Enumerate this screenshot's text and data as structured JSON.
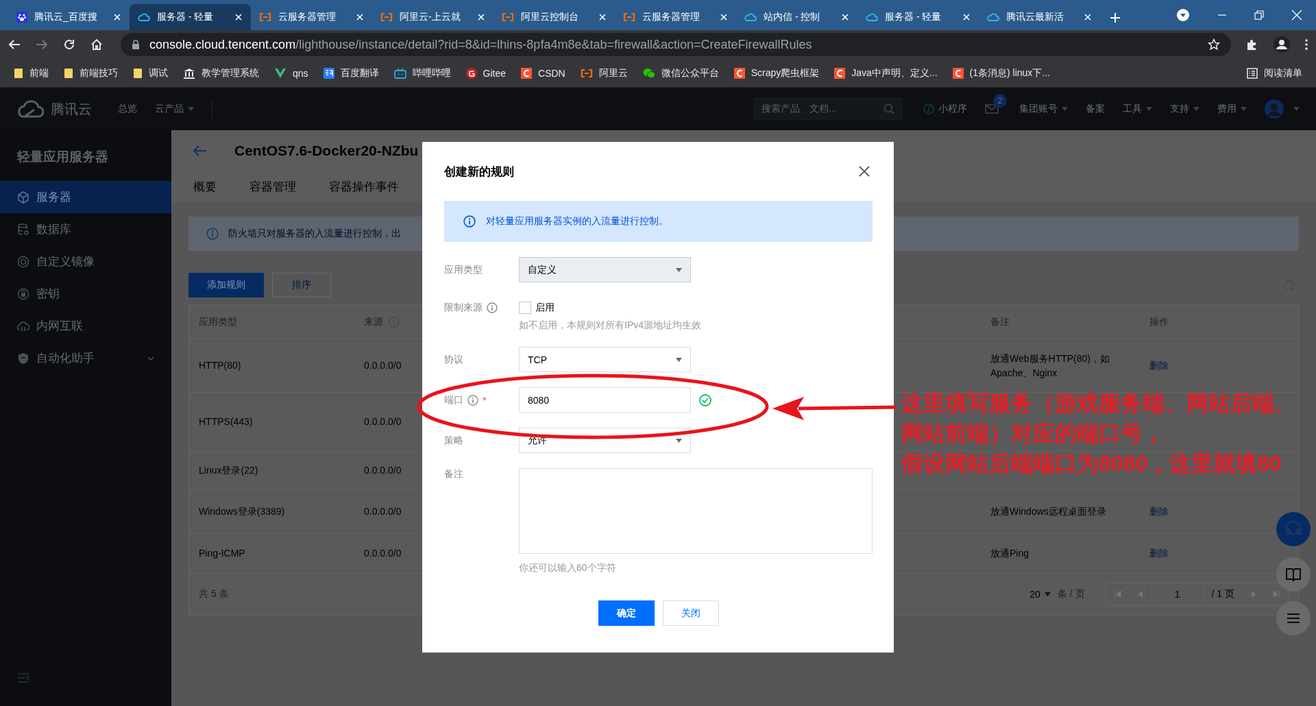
{
  "browser": {
    "tabs": [
      {
        "title": "腾讯云_百度搜",
        "selected": false
      },
      {
        "title": "服务器 - 轻量",
        "selected": true
      },
      {
        "title": "云服务器管理",
        "selected": false
      },
      {
        "title": "阿里云-上云就",
        "selected": false
      },
      {
        "title": "阿里云控制台",
        "selected": false
      },
      {
        "title": "云服务器管理",
        "selected": false
      },
      {
        "title": "站内信 - 控制",
        "selected": false
      },
      {
        "title": "服务器 - 轻量",
        "selected": false
      },
      {
        "title": "腾讯云最新活",
        "selected": false
      }
    ],
    "address": {
      "host": "console.cloud.tencent.com",
      "path": "/lighthouse/instance/detail?rid=8&id=lhins-8pfa4m8e&tab=firewall&action=CreateFirewallRules"
    },
    "bookmarks": [
      "前端",
      "前端技巧",
      "调试",
      "教学管理系统",
      "qns",
      "百度翻译",
      "哔哩哔哩",
      "Gitee",
      "CSDN",
      "阿里云",
      "微信公众平台",
      "Scrapy爬虫框架",
      "Java中声明、定义...",
      "(1条消息) linux下..."
    ],
    "reading_list": "阅读清单"
  },
  "console": {
    "nav": {
      "brand": "腾讯云",
      "items": [
        {
          "label": "总览",
          "dropdown": false
        },
        {
          "label": "云产品",
          "dropdown": true
        }
      ],
      "search": {
        "placeholder": "搜索产品、文档..."
      },
      "mini_program": "小程序",
      "mail_badge": "2",
      "menus": [
        {
          "label": "集团账号",
          "dropdown": true
        },
        {
          "label": "备案",
          "dropdown": false
        },
        {
          "label": "工具",
          "dropdown": true
        },
        {
          "label": "支持",
          "dropdown": true
        },
        {
          "label": "费用",
          "dropdown": true
        }
      ]
    },
    "sidebar": {
      "title": "轻量应用服务器",
      "items": [
        {
          "label": "服务器",
          "selected": true,
          "expandable": false
        },
        {
          "label": "数据库",
          "selected": false,
          "expandable": false
        },
        {
          "label": "自定义镜像",
          "selected": false,
          "expandable": false
        },
        {
          "label": "密钥",
          "selected": false,
          "expandable": false
        },
        {
          "label": "内网互联",
          "selected": false,
          "expandable": false
        },
        {
          "label": "自动化助手",
          "selected": false,
          "expandable": true
        }
      ]
    },
    "instance": {
      "title": "CentOS7.6-Docker20-NZbu",
      "tabs": [
        {
          "label": "概要",
          "selected": false
        },
        {
          "label": "容器管理",
          "selected": false
        },
        {
          "label": "容器操作事件",
          "selected": false
        }
      ],
      "notice": "防火墙只对服务器的入流量进行控制，出",
      "actions": [
        {
          "label": "添加规则",
          "kind": "primary"
        },
        {
          "label": "排序",
          "kind": "default"
        }
      ],
      "table": {
        "columns": [
          {
            "label": "应用类型",
            "info": false
          },
          {
            "label": "来源",
            "info": true
          },
          {
            "label": "备注",
            "info": false
          },
          {
            "label": "操作",
            "info": false
          }
        ],
        "rows": [
          {
            "app_type": "HTTP(80)",
            "source": "0.0.0.0/0",
            "note": "放通Web服务HTTP(80)，如Apache、Nginx",
            "action": "删除"
          },
          {
            "app_type": "HTTPS(443)",
            "source": "0.0.0.0/0"
          },
          {
            "app_type": "Linux登录(22)",
            "source": "0.0.0.0/0"
          },
          {
            "app_type": "Windows登录(3389)",
            "source": "0.0.0.0/0",
            "note": "放通Windows远程桌面登录",
            "action": "删除"
          },
          {
            "app_type": "Ping-ICMP",
            "source": "0.0.0.0/0",
            "note": "放通Ping",
            "action": "删除"
          }
        ],
        "total": "共 5 条",
        "page_size": "20",
        "page_size_unit": "条 / 页",
        "page": "1",
        "page_count": "/ 1 页"
      }
    }
  },
  "dialog": {
    "title": "创建新的规则",
    "info": "对轻量应用服务器实例的入流量进行控制。",
    "fields": [
      {
        "label": "应用类型",
        "kind": "select",
        "value": "自定义",
        "info": false,
        "disabled": true
      },
      {
        "label": "限制来源",
        "kind": "checkbox",
        "option": "启用",
        "checked": false,
        "hint": "如不启用，本规则对所有IPv4源地址均生效",
        "info": true
      },
      {
        "label": "协议",
        "kind": "select",
        "value": "TCP",
        "info": false,
        "disabled": false
      },
      {
        "label": "端口",
        "kind": "input",
        "value": "8080",
        "valid": true,
        "info": true,
        "required_mark": "*",
        "disabled": false
      },
      {
        "label": "策略",
        "kind": "select",
        "value": "允许",
        "info": false,
        "disabled": false
      },
      {
        "label": "备注",
        "kind": "textarea",
        "hint": "你还可以输入60个字符",
        "info": false,
        "disabled": false
      }
    ],
    "buttons": [
      {
        "label": "确定",
        "kind": "primary"
      },
      {
        "label": "关闭",
        "kind": "default"
      }
    ]
  },
  "annotation": {
    "lines": [
      "这里填写服务（游戏服务端、网站后端、",
      "网站前端）对应的端口号，",
      "假设网站后端端口为8080，这里就填80"
    ]
  }
}
